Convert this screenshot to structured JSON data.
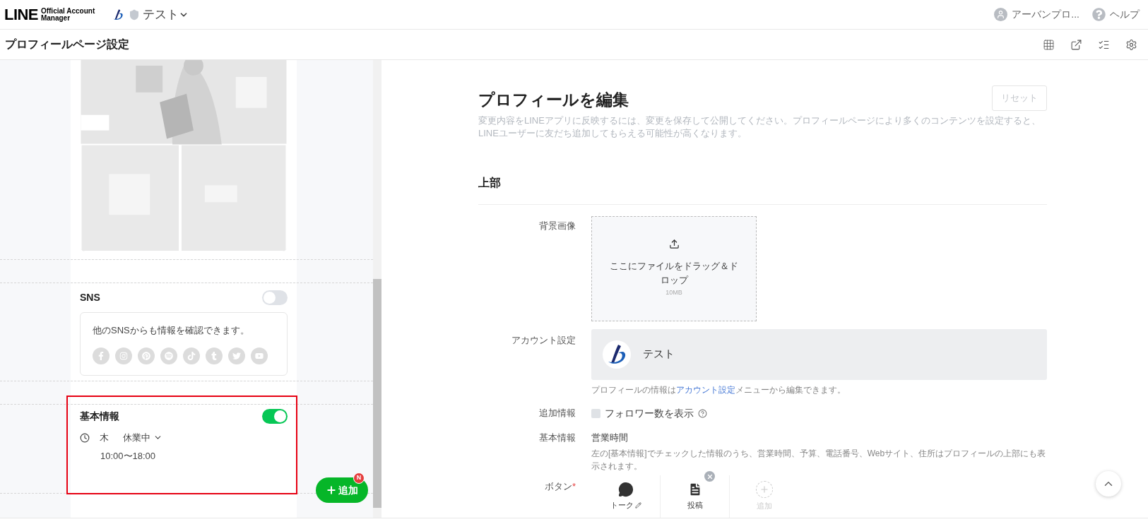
{
  "header": {
    "logo": "LINE",
    "logo_sub": [
      "Official Account",
      "Manager"
    ],
    "account": "テスト",
    "user": "アーバンプロ...",
    "help": "ヘルプ"
  },
  "page_title": "プロフィールページ設定",
  "preview": {
    "sns": {
      "title": "SNS",
      "on": false,
      "text": "他のSNSからも情報を確認できます。"
    },
    "basic": {
      "title": "基本情報",
      "on": true,
      "highlighted": true,
      "day": "木",
      "status": "休業中",
      "hours": "10:00〜18:00"
    },
    "add_button": {
      "label": "追加",
      "badge": "N"
    }
  },
  "editor": {
    "title": "プロフィールを編集",
    "reset": "リセット",
    "description": "変更内容をLINEアプリに反映するには、変更を保存して公開してください。プロフィールページにより多くのコンテンツを設定すると、LINEユーザーに友だち追加してもらえる可能性が高くなります。",
    "section": "上部",
    "background": {
      "label": "背景画像",
      "drop_text": "ここにファイルをドラッグ＆ドロップ",
      "size": "10MB"
    },
    "account": {
      "label": "アカウント設定",
      "name": "テスト",
      "note_parts": [
        "プロフィールの情報は",
        "アカウント設定",
        "メニューから編集できます。"
      ]
    },
    "extra": {
      "label": "追加情報",
      "checkbox": "フォロワー数を表示",
      "checked": false
    },
    "basic": {
      "label": "基本情報",
      "value": "営業時間",
      "note": "左の[基本情報]でチェックした情報のうち、営業時間、予算、電話番号、Webサイト、住所はプロフィールの上部にも表示されます。"
    },
    "buttons": {
      "label": "ボタン",
      "required": "*",
      "items": [
        {
          "kind": "talk",
          "label": "トーク"
        },
        {
          "kind": "post",
          "label": "投稿"
        },
        {
          "kind": "add",
          "label": "追加"
        }
      ]
    }
  }
}
